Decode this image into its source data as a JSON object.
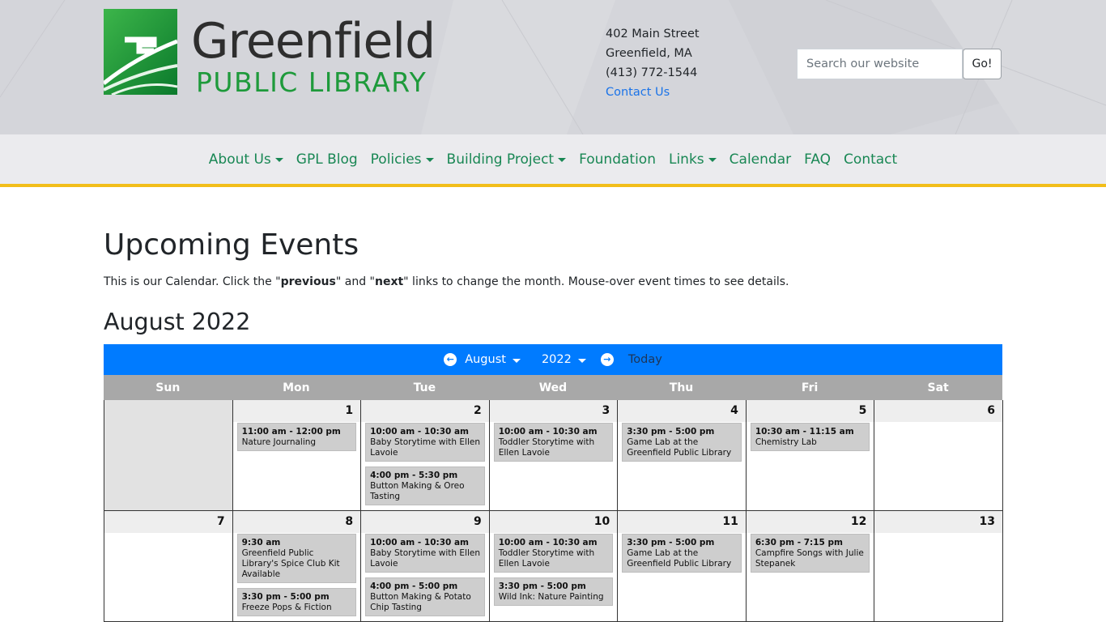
{
  "header": {
    "logo_title": "Greenfield",
    "logo_subtitle": "PUBLIC LIBRARY",
    "address": [
      "402 Main Street",
      "Greenfield, MA",
      "(413) 772-1544"
    ],
    "contact_link": "Contact Us",
    "search_placeholder": "Search our website",
    "search_button": "Go!"
  },
  "nav": {
    "items": [
      {
        "label": "About Us",
        "dropdown": true
      },
      {
        "label": "GPL Blog",
        "dropdown": false
      },
      {
        "label": "Policies",
        "dropdown": true
      },
      {
        "label": "Building Project",
        "dropdown": true
      },
      {
        "label": "Foundation",
        "dropdown": false
      },
      {
        "label": "Links",
        "dropdown": true
      },
      {
        "label": "Calendar",
        "dropdown": false
      },
      {
        "label": "FAQ",
        "dropdown": false
      },
      {
        "label": "Contact",
        "dropdown": false
      }
    ]
  },
  "main": {
    "title": "Upcoming Events",
    "intro_before": "This is our Calendar. Click the \"",
    "intro_prev": "previous",
    "intro_mid": "\" and \"",
    "intro_next": "next",
    "intro_after": "\" links to change the month. Mouse-over event times to see details.",
    "month_title": "August 2022"
  },
  "calendar": {
    "month": "August",
    "year": "2022",
    "today": "Today",
    "days_of_week": [
      "Sun",
      "Mon",
      "Tue",
      "Wed",
      "Thu",
      "Fri",
      "Sat"
    ],
    "weeks": [
      {
        "height": 137,
        "days": [
          {
            "num": "",
            "events": []
          },
          {
            "num": "1",
            "events": [
              {
                "time": "11:00 am - 12:00 pm",
                "name": "Nature Journaling"
              }
            ]
          },
          {
            "num": "2",
            "events": [
              {
                "time": "10:00 am - 10:30 am",
                "name": "Baby Storytime with Ellen Lavoie"
              },
              {
                "time": "4:00 pm - 5:30 pm",
                "name": "Button Making & Oreo Tasting"
              }
            ]
          },
          {
            "num": "3",
            "events": [
              {
                "time": "10:00 am - 10:30 am",
                "name": "Toddler Storytime with Ellen Lavoie"
              }
            ]
          },
          {
            "num": "4",
            "events": [
              {
                "time": "3:30 pm - 5:00 pm",
                "name": "Game Lab at the Greenfield Public Library"
              }
            ]
          },
          {
            "num": "5",
            "events": [
              {
                "time": "10:30 am - 11:15 am",
                "name": "Chemistry Lab"
              }
            ]
          },
          {
            "num": "6",
            "events": []
          }
        ]
      },
      {
        "height": 137,
        "days": [
          {
            "num": "7",
            "events": []
          },
          {
            "num": "8",
            "events": [
              {
                "time": "9:30 am",
                "name": "Greenfield Public Library's Spice Club Kit Available"
              },
              {
                "time": "3:30 pm - 5:00 pm",
                "name": "Freeze Pops & Fiction"
              }
            ]
          },
          {
            "num": "9",
            "events": [
              {
                "time": "10:00 am - 10:30 am",
                "name": "Baby Storytime with Ellen Lavoie"
              },
              {
                "time": "4:00 pm - 5:00 pm",
                "name": "Button Making & Potato Chip Tasting"
              }
            ]
          },
          {
            "num": "10",
            "events": [
              {
                "time": "10:00 am - 10:30 am",
                "name": "Toddler Storytime with Ellen Lavoie"
              },
              {
                "time": "3:30 pm - 5:00 pm",
                "name": "Wild Ink: Nature Painting"
              }
            ]
          },
          {
            "num": "11",
            "events": [
              {
                "time": "3:30 pm - 5:00 pm",
                "name": "Game Lab at the Greenfield Public Library"
              }
            ]
          },
          {
            "num": "12",
            "events": [
              {
                "time": "6:30 pm - 7:15 pm",
                "name": "Campfire Songs with Julie Stepanek"
              }
            ]
          },
          {
            "num": "13",
            "events": []
          }
        ]
      }
    ]
  },
  "colors": {
    "brand_green": "#1e9a3b",
    "nav_link": "#198754",
    "accent_yellow": "#f2be1a",
    "calendar_bar": "#007bff"
  }
}
